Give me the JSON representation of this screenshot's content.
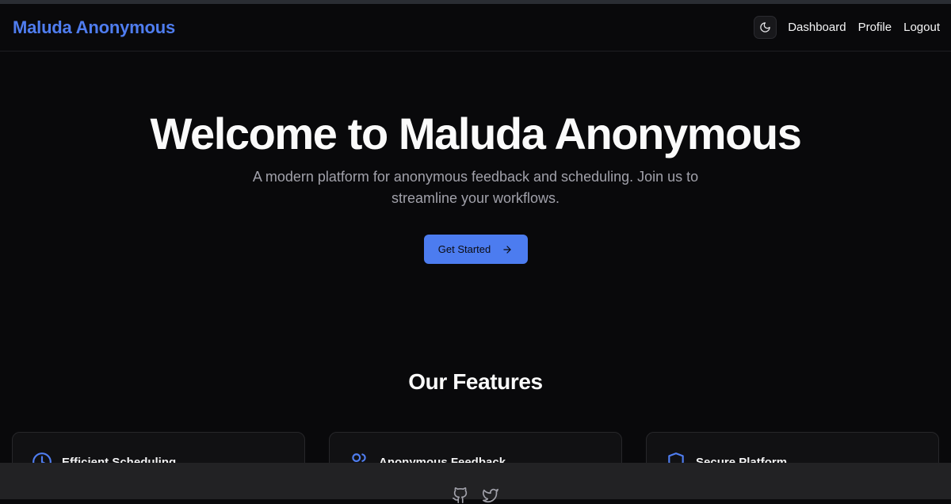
{
  "navbar": {
    "brand": "Maluda Anonymous",
    "theme_toggle_icon": "moon-icon",
    "links": [
      "Dashboard",
      "Profile",
      "Logout"
    ]
  },
  "hero": {
    "title": "Welcome to Maluda Anonymous",
    "subtitle": "A modern platform for anonymous feedback and scheduling. Join us to streamline your workflows.",
    "cta_label": "Get Started",
    "cta_icon": "arrow-right-icon"
  },
  "features": {
    "title": "Our Features",
    "cards": [
      {
        "title": "Efficient Scheduling",
        "icon": "clock-icon"
      },
      {
        "title": "Anonymous Feedback",
        "icon": "users-icon"
      },
      {
        "title": "Secure Platform",
        "icon": "shield-icon"
      }
    ]
  },
  "footer": {
    "icons": [
      "github-icon",
      "twitter-icon"
    ]
  },
  "colors": {
    "background": "#09090b",
    "accent": "#4f7df0",
    "card": "#111113",
    "footer": "#222224"
  }
}
